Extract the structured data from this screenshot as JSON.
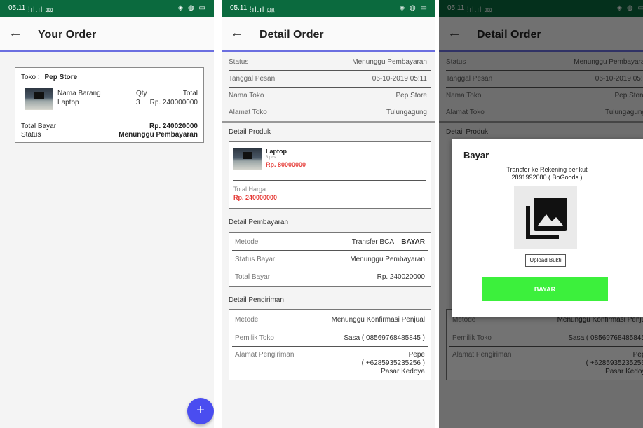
{
  "status_bar": {
    "time": "05.11",
    "signal": "⫶ıl.ıl ⅏",
    "icons": "◈ ◍ ▭"
  },
  "screen1": {
    "title": "Your Order",
    "order": {
      "store_label": "Toko :",
      "store_name": "Pep Store",
      "item_label": "Nama Barang",
      "item_name": "Laptop",
      "qty_label": "Qty",
      "qty_value": "3",
      "total_label": "Total",
      "total_value": "Rp. 240000000",
      "total_bayar_label": "Total Bayar",
      "total_bayar_value": "Rp. 240020000",
      "status_label": "Status",
      "status_value": "Menunggu Pembayaran"
    },
    "fab_label": "+"
  },
  "screen2": {
    "title": "Detail Order",
    "info": [
      {
        "label": "Status",
        "value": "Menunggu Pembayaran"
      },
      {
        "label": "Tanggal Pesan",
        "value": "06-10-2019 05:11"
      },
      {
        "label": "Nama Toko",
        "value": "Pep Store"
      },
      {
        "label": "Alamat Toko",
        "value": "Tulungagung"
      }
    ],
    "produk": {
      "section": "Detail Produk",
      "name": "Laptop",
      "qty": "3 pcs",
      "price": "Rp. 80000000",
      "total_label": "Total Harga",
      "total_value": "Rp. 240000000"
    },
    "pembayaran": {
      "section": "Detail Pembayaran",
      "metode_label": "Metode",
      "metode_value": "Transfer BCA",
      "bayar_link": "BAYAR",
      "status_label": "Status Bayar",
      "status_value": "Menunggu Pembayaran",
      "total_label": "Total Bayar",
      "total_value": "Rp. 240020000"
    },
    "pengiriman": {
      "section": "Detail Pengiriman",
      "metode_label": "Metode",
      "metode_value": "Menunggu Konfirmasi Penjual",
      "pemilik_label": "Pemilik Toko",
      "pemilik_value": "Sasa ( 08569768485845 )",
      "alamat_label": "Alamat Pengiriman",
      "alamat_line1": "Pepe",
      "alamat_line2": "( +6285935235256 )",
      "alamat_line3": "Pasar Kedoya"
    }
  },
  "dialog": {
    "title": "Bayar",
    "text_line1": "Transfer ke Rekening berikut",
    "text_line2": "2891992080 ( BoGoods )",
    "upload_label": "Upload Bukti",
    "pay_label": "BAYAR",
    "icon": "image-gallery-icon"
  },
  "colors": {
    "status_bar": "#0b6a3e",
    "appbar_underline": "#6b6fe0",
    "fab": "#4a4df0",
    "accent_red": "#e53935",
    "pay_button": "#3cf03c"
  }
}
